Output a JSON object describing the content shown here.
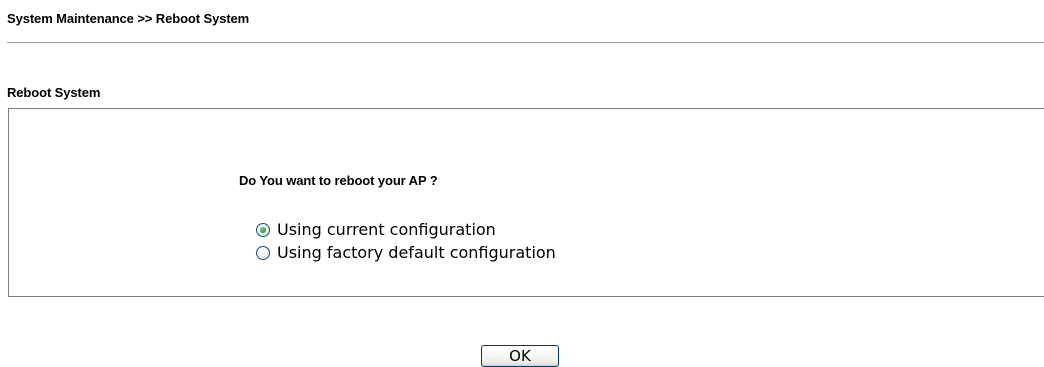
{
  "header": {
    "breadcrumb": "System Maintenance >> Reboot System"
  },
  "reboot_section": {
    "title": "Reboot System",
    "question": "Do You want to reboot your AP ?",
    "options": [
      {
        "label": "Using current configuration",
        "selected": true
      },
      {
        "label": "Using factory default configuration",
        "selected": false
      }
    ]
  },
  "actions": {
    "ok_label": "OK"
  },
  "colors": {
    "border": "#7f7f7f",
    "rule": "#9a9a9a",
    "radio_border": "#1c5180",
    "radio_selected_dot": "#2a9b2a",
    "button_border": "#003c74"
  }
}
